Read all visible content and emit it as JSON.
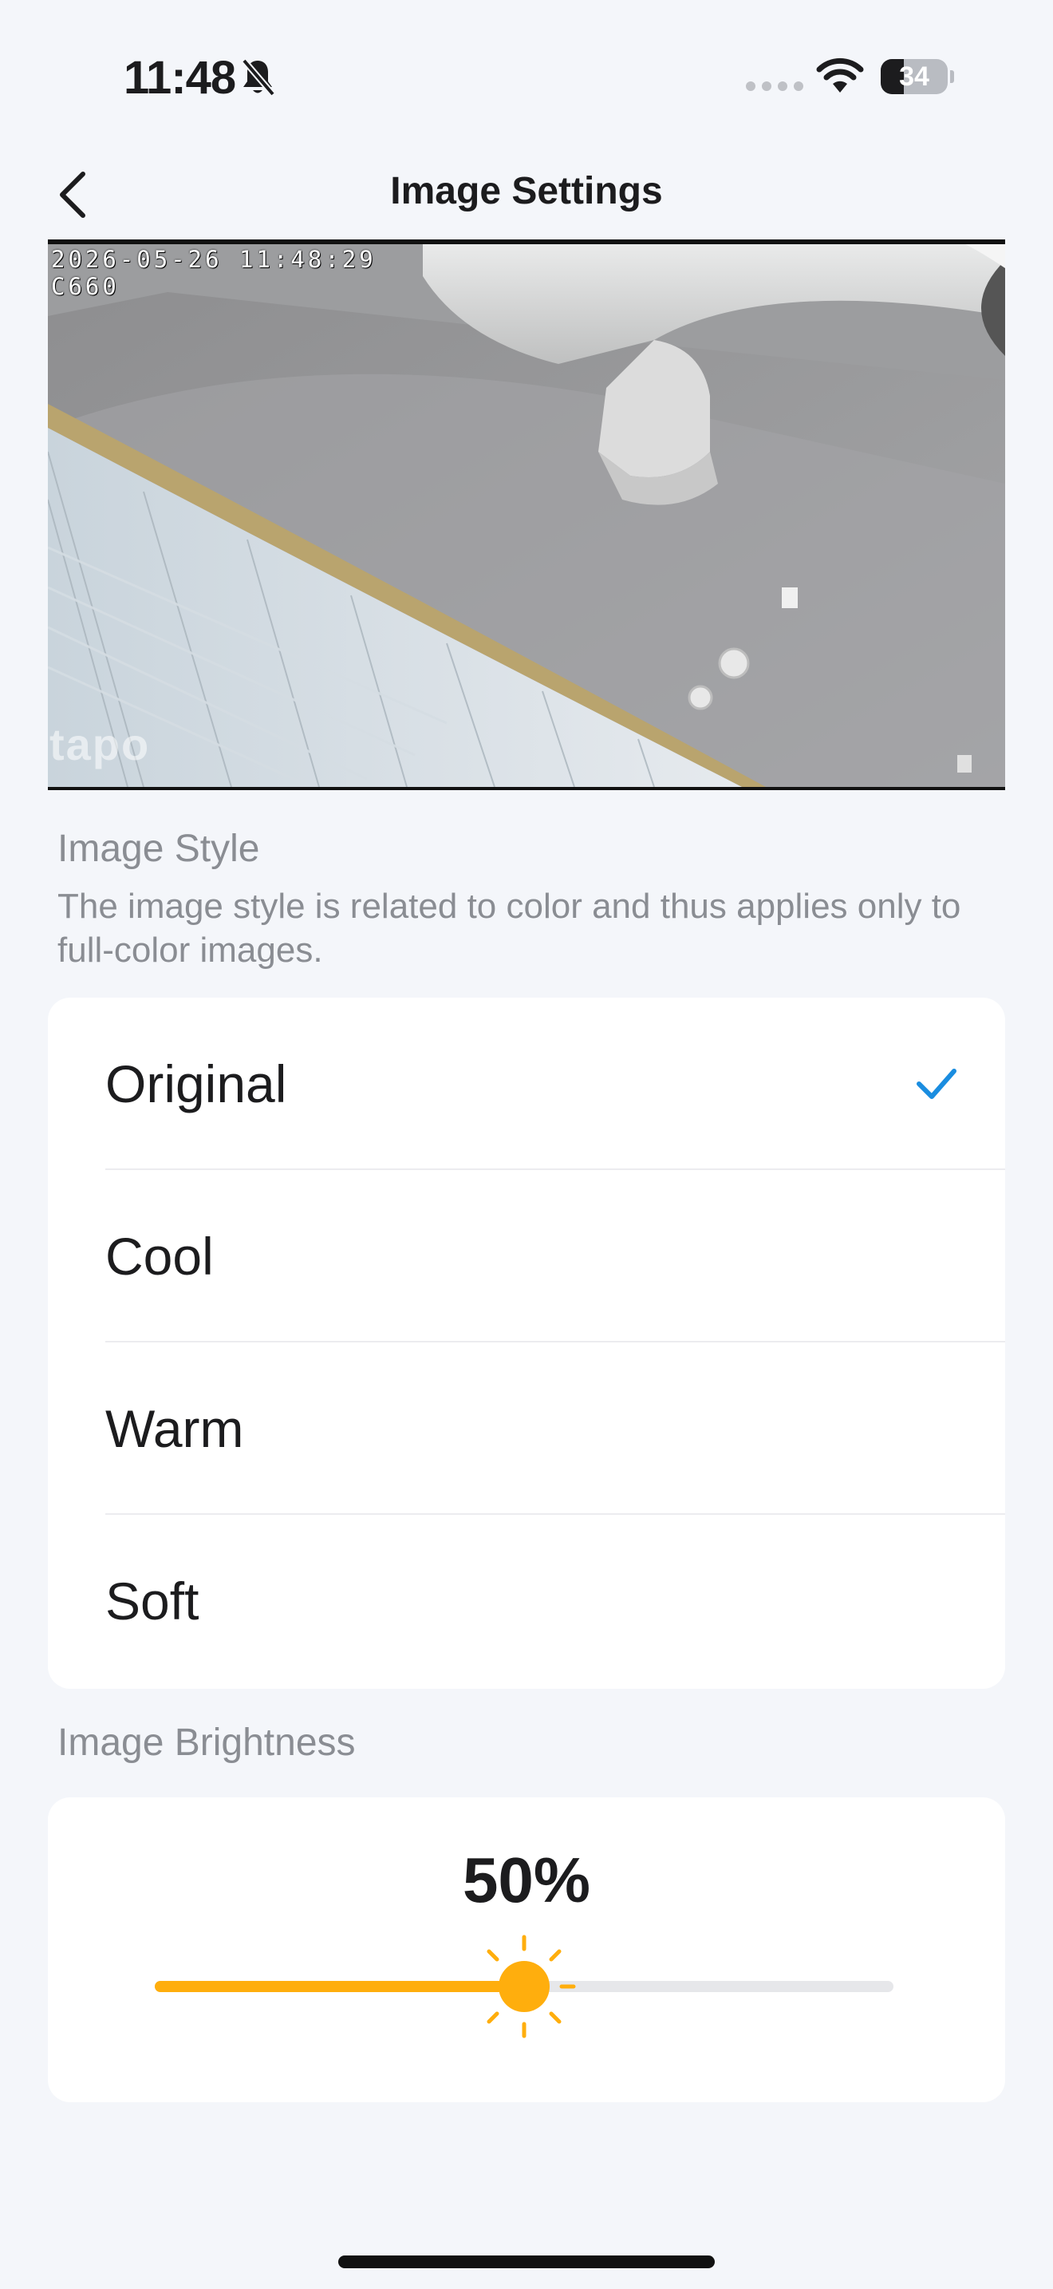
{
  "status_bar": {
    "time": "11:48",
    "battery_level": "34",
    "icons": [
      "bell-slash-icon",
      "cellular-dots-icon",
      "wifi-icon",
      "battery-icon"
    ]
  },
  "nav": {
    "title": "Image Settings",
    "back_icon": "chevron-left-icon"
  },
  "preview": {
    "timestamp": "2026-05-26 11:48:29",
    "camera_model": "C660",
    "watermark": "tapo"
  },
  "image_style": {
    "title": "Image Style",
    "description": "The image style is related to color and thus applies only to full-color images.",
    "options": [
      {
        "label": "Original",
        "selected": true
      },
      {
        "label": "Cool",
        "selected": false
      },
      {
        "label": "Warm",
        "selected": false
      },
      {
        "label": "Soft",
        "selected": false
      }
    ],
    "check_icon": "checkmark-icon"
  },
  "image_brightness": {
    "title": "Image Brightness",
    "value_label": "50%",
    "value": 0.5,
    "thumb_icon": "sun-icon"
  },
  "colors": {
    "accent_check": "#1a8de0",
    "slider_accent": "#ffae0d",
    "background": "#f4f6fa",
    "card": "#ffffff"
  }
}
